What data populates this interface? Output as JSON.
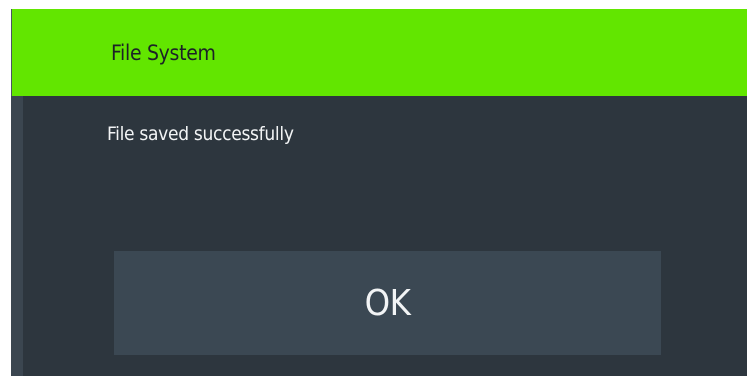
{
  "dialog": {
    "title": "File System",
    "message": "File saved successfully",
    "ok_label": "OK"
  },
  "colors": {
    "header": "#62e600",
    "body": "#2d363e",
    "button": "#3b4853",
    "text_light": "#f2f4f5",
    "text_dark": "#1c2226"
  }
}
